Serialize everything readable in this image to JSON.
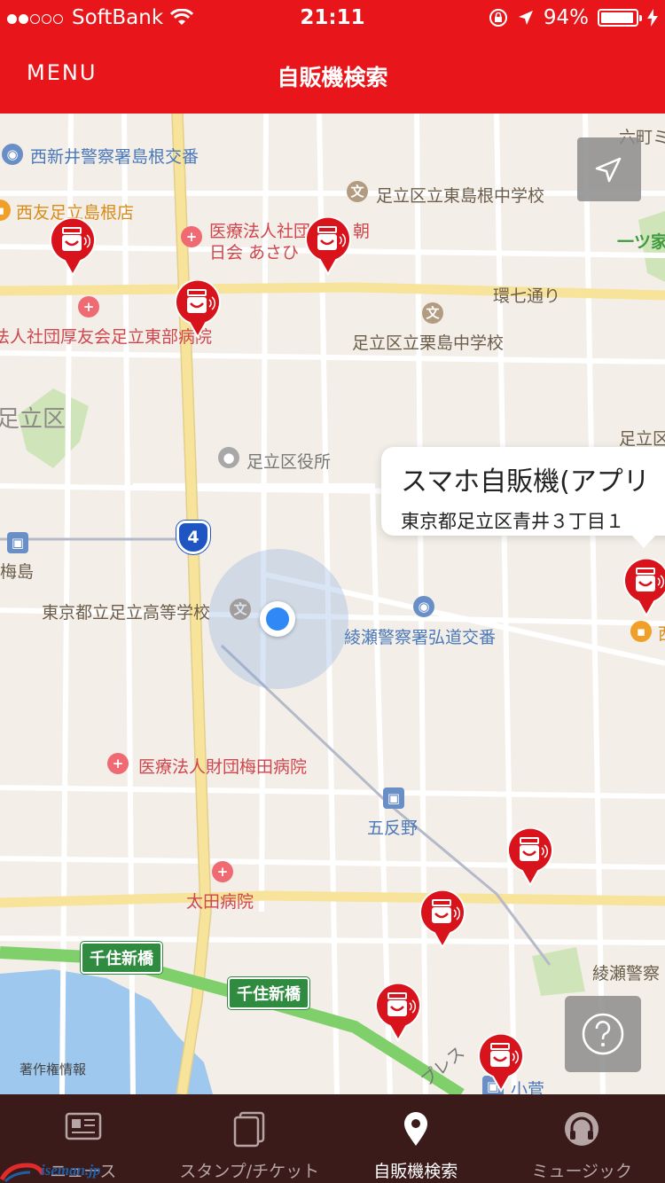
{
  "status_bar": {
    "carrier": "SoftBank",
    "time": "21:11",
    "battery": "94%",
    "battery_level": 0.94
  },
  "nav": {
    "menu_label": "MENU",
    "title": "自販機検索"
  },
  "map": {
    "labels": {
      "koban_nishiarai": "西新井警察署島根交番",
      "nishitomo": "西友足立島根店",
      "higashi_jhs": "足立区立東島根中学校",
      "iryo_asahi_1": "医療法人社団",
      "iryo_asahi_2": "朝",
      "iryo_asahi_3": "日会 あさひ",
      "kan7": "環七通り",
      "kosei": "法人社団厚友会足立東部病院",
      "kurijima_jhs": "足立区立栗島中学校",
      "adachi_ku": "足立区",
      "kuyakusho": "足立区役所",
      "adachi_right": "足立区",
      "umejima": "梅島",
      "adachi_hs": "東京都立足立高等学校",
      "ayase_koban": "綾瀬警察署弘道交番",
      "umeda_hosp": "医療法人財団梅田病院",
      "gotanno": "五反野",
      "ota_hosp": "太田病院",
      "ayase_keisatsu": "綾瀬警察",
      "kosuge": "小菅",
      "rokucho": "六町ミ",
      "hitotsuya": "一ツ家",
      "express": "プレス",
      "right_edge_shop": "西"
    },
    "route_number": "4",
    "road_signs": [
      "千住新橋",
      "千住新橋"
    ],
    "copyright": "著作権情報",
    "callout": {
      "title": "スマホ自販機(アプリ",
      "address": "東京都足立区青井３丁目１"
    }
  },
  "tabs": [
    {
      "label": "ニュース",
      "icon": "news-icon"
    },
    {
      "label": "スタンプ/チケット",
      "icon": "stamp-ticket-icon"
    },
    {
      "label": "自販機検索",
      "icon": "map-pin-icon",
      "active": true
    },
    {
      "label": "ミュージック",
      "icon": "headphones-icon"
    }
  ],
  "watermark": "iseman.jp",
  "colors": {
    "brand_red": "#e8161a",
    "tabbar_bg": "#3b1a1a",
    "user_location": "#2f88f5"
  }
}
